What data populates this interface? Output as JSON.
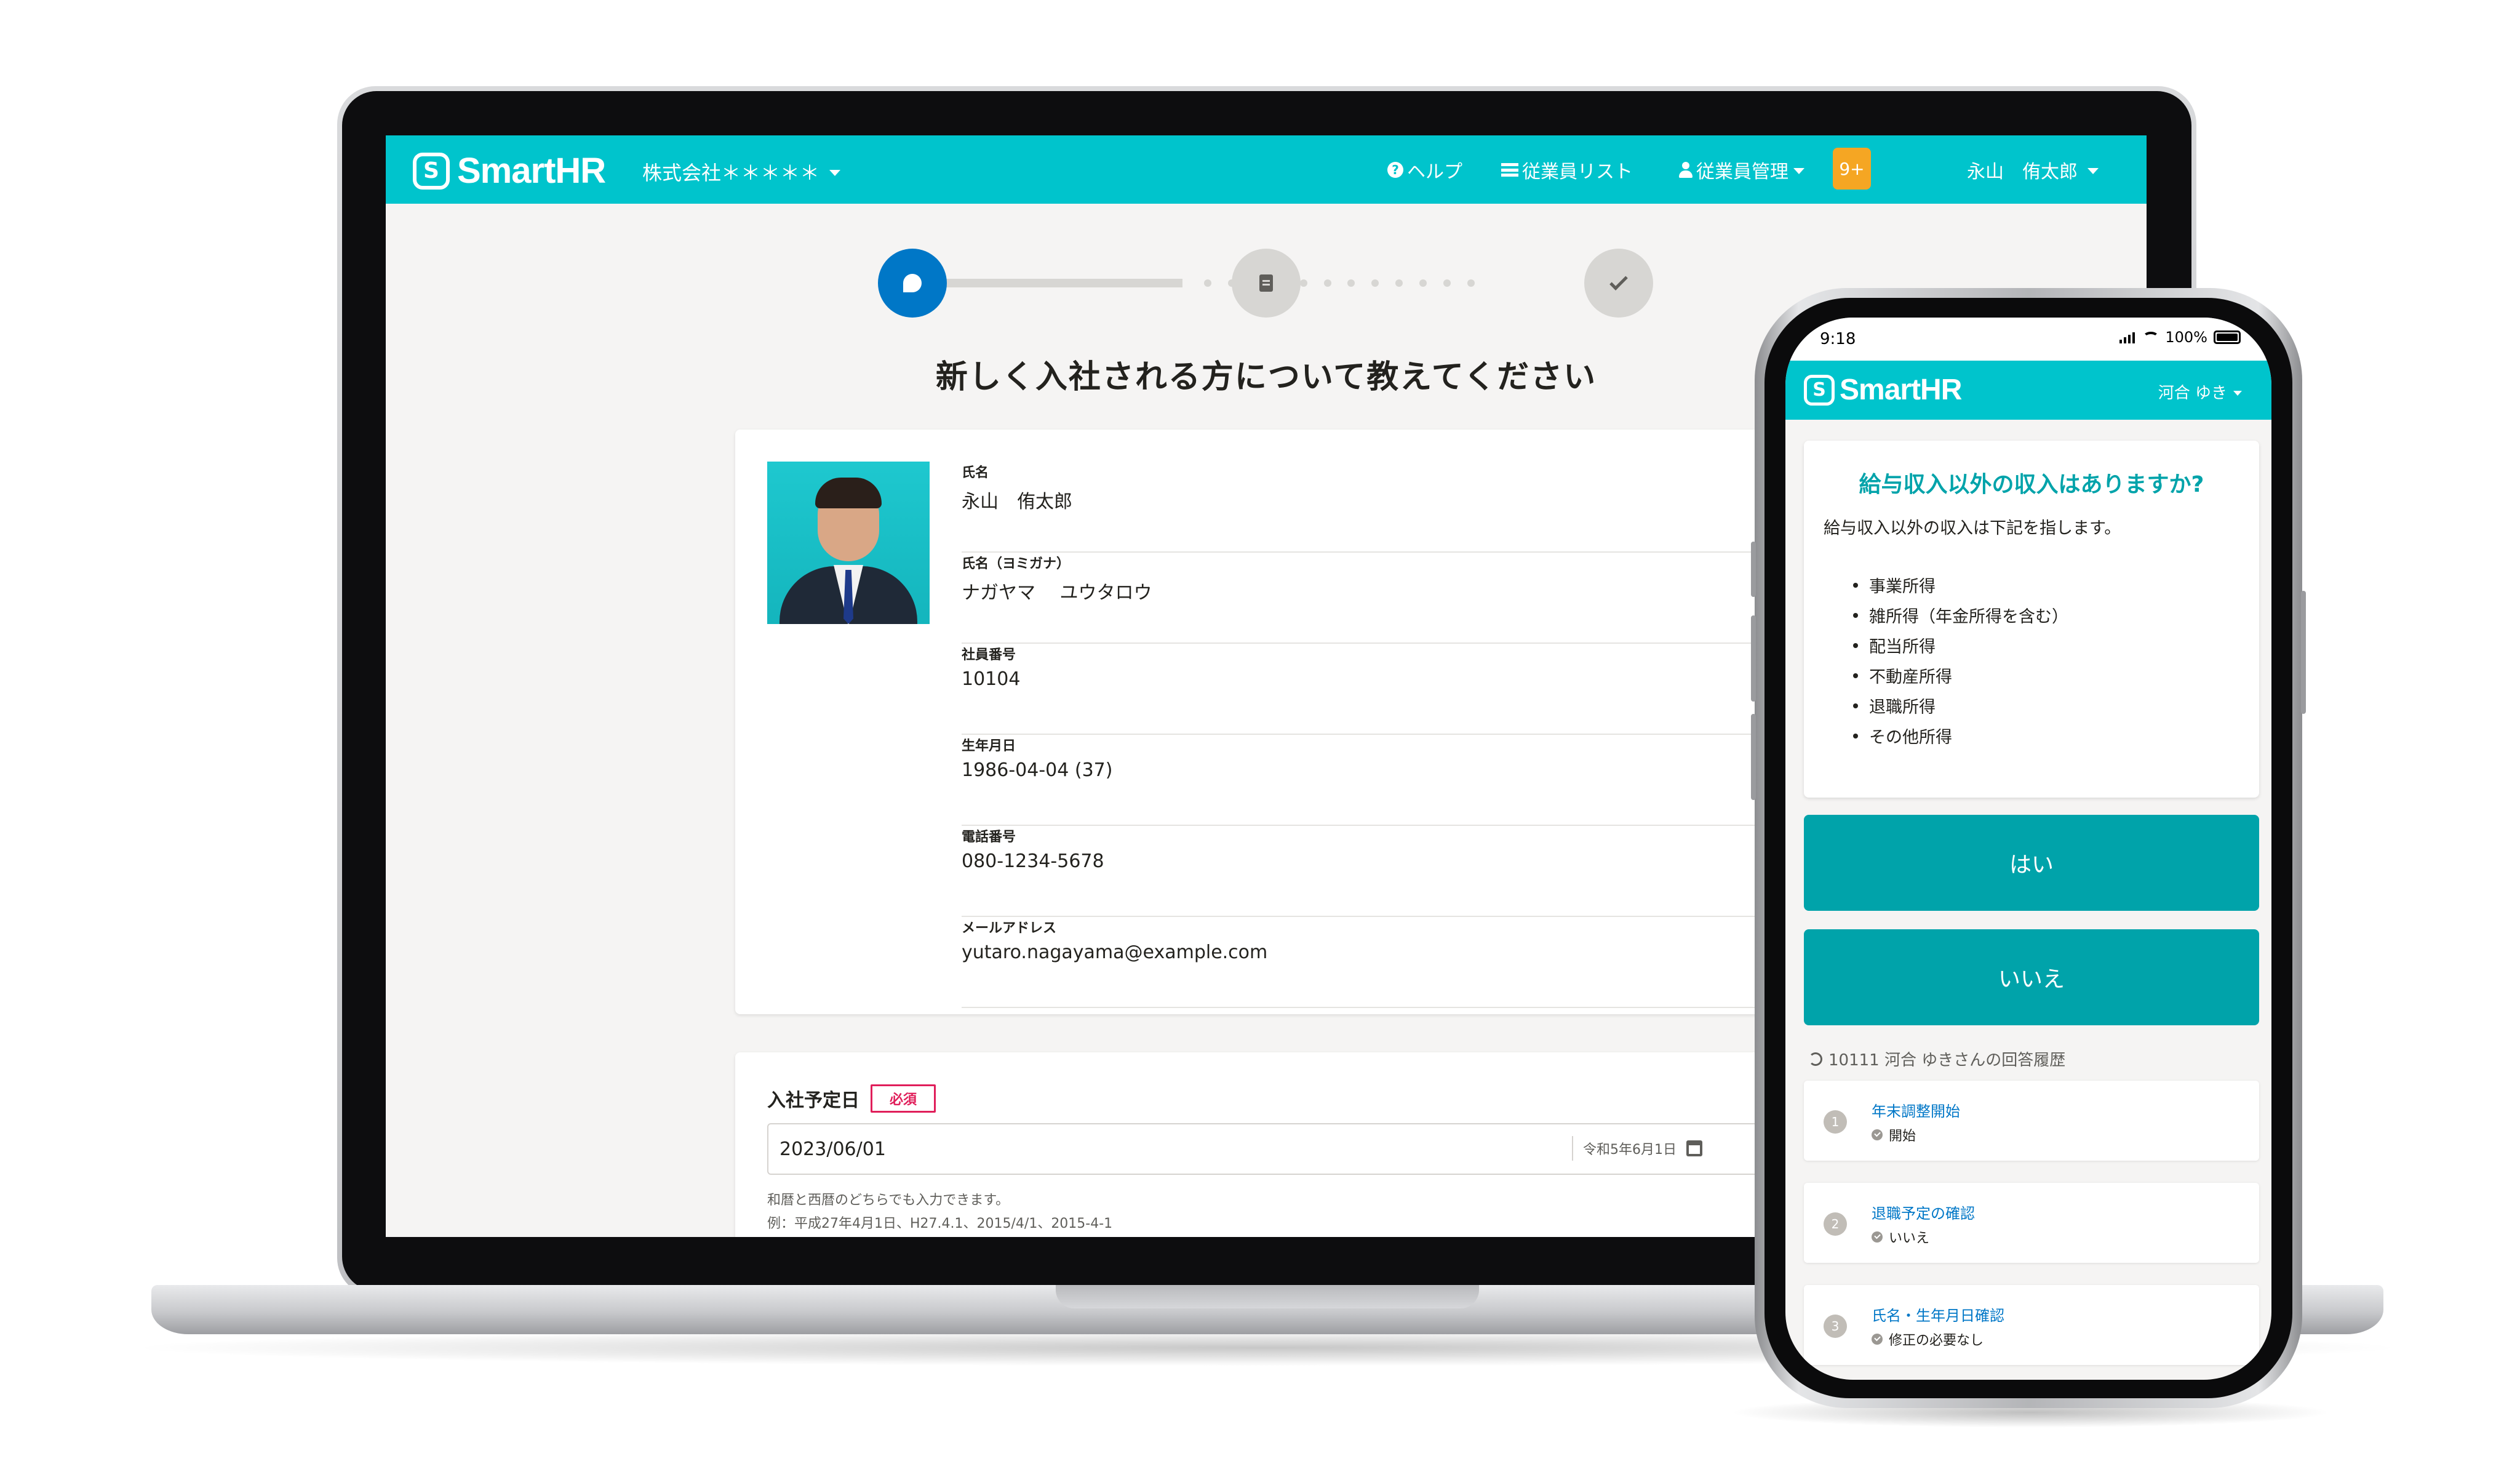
{
  "laptop": {
    "header": {
      "brand": "SmartHR",
      "brand_mark": "S",
      "company": "株式会社＊＊＊＊＊",
      "nav": {
        "help": "ヘルプ",
        "employee_list": "従業員リスト",
        "employee_management": "従業員管理"
      },
      "notification_badge": "9+",
      "user_name": "永山　侑太郎"
    },
    "stepper": {
      "current_step": 1,
      "total_steps": 3
    },
    "page_title": "新しく入社される方について教えてください",
    "profile": {
      "fields": [
        {
          "label": "氏名",
          "value": "永山　侑太郎"
        },
        {
          "label": "氏名（ヨミガナ）",
          "value": "ナガヤマ　 ユウタロウ"
        },
        {
          "label": "社員番号",
          "value": "10104"
        },
        {
          "label": "生年月日",
          "value": "1986-04-04 (37)"
        },
        {
          "label": "電話番号",
          "value": "080-1234-5678"
        },
        {
          "label": "メールアドレス",
          "value": "yutaro.nagayama@example.com"
        }
      ]
    },
    "join_date": {
      "label": "入社予定日",
      "required": "必須",
      "value": "2023/06/01",
      "era_display": "令和5年6月1日",
      "hint1": "和暦と西暦のどちらでも入力できます。",
      "hint2": "例：平成27年4月1日、H27.4.1、2015/4/1、2015-4-1"
    }
  },
  "phone": {
    "status": {
      "time": "9:18",
      "battery": "100%"
    },
    "header": {
      "brand": "SmartHR",
      "brand_mark": "S",
      "user": "河合 ゆき"
    },
    "question": {
      "title": "給与収入以外の収入はありますか?",
      "description": "給与収入以外の収入は下記を指します。",
      "items": [
        "事業所得",
        "雑所得（年金所得を含む）",
        "配当所得",
        "不動産所得",
        "退職所得",
        "その他所得"
      ]
    },
    "buttons": {
      "yes": "はい",
      "no": "いいえ"
    },
    "history": {
      "title": "10111 河合 ゆきさんの回答履歴",
      "items": [
        {
          "num": "1",
          "title": "年末調整開始",
          "answer": "開始"
        },
        {
          "num": "2",
          "title": "退職予定の確認",
          "answer": "いいえ"
        },
        {
          "num": "3",
          "title": "氏名・生年月日確認",
          "answer": "修正の必要なし"
        }
      ]
    }
  },
  "colors": {
    "brand": "#00c4cc",
    "button": "#00a3aa",
    "step_active": "#0077c7",
    "badge": "#f5a623",
    "required": "#e01e5a"
  }
}
